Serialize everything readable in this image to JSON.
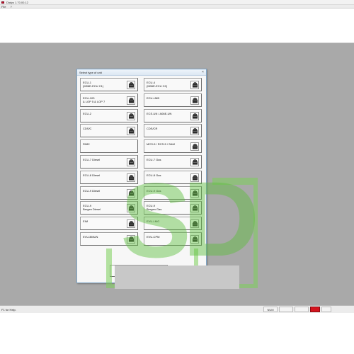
{
  "window": {
    "title": "Dialys 1.70.00.12",
    "menu": [
      "File",
      "?"
    ]
  },
  "dialog": {
    "title": "Select type of unit",
    "close_label": "×",
    "units": [
      {
        "label": "ECU-1\n(M06E-ECU C1)",
        "icon": "box-icon"
      },
      {
        "label": "ECU-4\n(M06E-ECU C2)",
        "icon": "box-icon"
      },
      {
        "label": "ECU-103\n& LOP 5 & LOP 7",
        "icon": "box-icon"
      },
      {
        "label": "ECU-LMB",
        "icon": "box-icon"
      },
      {
        "label": "ECU-2",
        "icon": "box-icon"
      },
      {
        "label": "ECS-UN / A06E-UN",
        "icon": "box-icon"
      },
      {
        "label": "CDS/C",
        "icon": "box-icon"
      },
      {
        "label": "CDS/CR",
        "icon": "box-icon"
      },
      {
        "label": "R082",
        "icon": ""
      },
      {
        "label": "MCS-5 / RCS-5 / SAM",
        "icon": "box-icon"
      },
      {
        "label": "ECU-7 Diesel",
        "icon": "box-icon"
      },
      {
        "label": "ECU-7 Gas",
        "icon": "box-icon"
      },
      {
        "label": "ECU-8 Diesel",
        "icon": "box-icon"
      },
      {
        "label": "ECU-8 Gas",
        "icon": "box-icon"
      },
      {
        "label": "ECU-9 Diesel",
        "icon": "box-icon"
      },
      {
        "label": "ECU-9 Gas",
        "icon": "box-icon"
      },
      {
        "label": "ECU-9\nBergen Diesel",
        "icon": "box-icon"
      },
      {
        "label": "ECU-9\nBergen Gas",
        "icon": "box-icon"
      },
      {
        "label": "EIM",
        "icon": "box-icon"
      },
      {
        "label": "EVU-LMG",
        "icon": "box-icon"
      },
      {
        "label": "EVU-BMUN",
        "icon": "box-icon"
      },
      {
        "label": "EVU-CPM",
        "icon": "box-icon"
      }
    ],
    "cancel_label": "Cancel",
    "cancel_icon": "exit-door-icon"
  },
  "statusbar": {
    "text": "F1 for Help.",
    "cells": [
      "NUM",
      "",
      "",
      ""
    ]
  },
  "colors": {
    "desktop": "#a9a9a9",
    "watermark": "#5cbf3c",
    "status_alert": "#d4141e"
  }
}
